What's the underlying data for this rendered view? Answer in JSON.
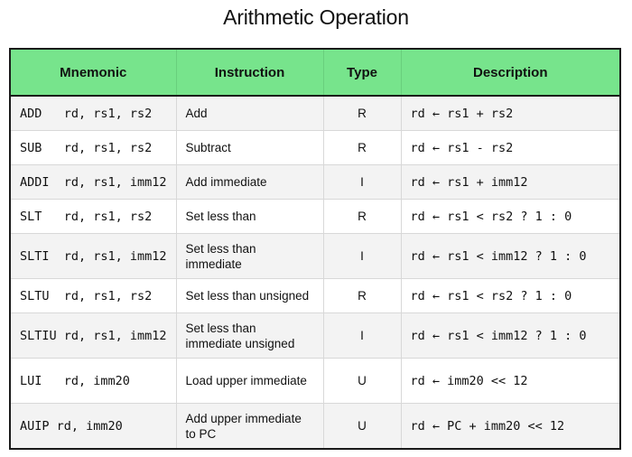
{
  "title": "Arithmetic Operation",
  "table": {
    "headers": [
      "Mnemonic",
      "Instruction",
      "Type",
      "Description"
    ],
    "rows": [
      {
        "mnemonic": "ADD   rd, rs1, rs2",
        "instruction": "Add",
        "type": "R",
        "description": "rd ← rs1 + rs2"
      },
      {
        "mnemonic": "SUB   rd, rs1, rs2",
        "instruction": "Subtract",
        "type": "R",
        "description": "rd ← rs1 - rs2"
      },
      {
        "mnemonic": "ADDI  rd, rs1, imm12",
        "instruction": "Add immediate",
        "type": "I",
        "description": "rd ← rs1 + imm12"
      },
      {
        "mnemonic": "SLT   rd, rs1, rs2",
        "instruction": "Set less than",
        "type": "R",
        "description": "rd ← rs1 < rs2 ? 1 : 0"
      },
      {
        "mnemonic": "SLTI  rd, rs1, imm12",
        "instruction": "Set less than immediate",
        "type": "I",
        "description": "rd ← rs1 < imm12 ? 1 : 0"
      },
      {
        "mnemonic": "SLTU  rd, rs1, rs2",
        "instruction": "Set less than unsigned",
        "type": "R",
        "description": "rd ← rs1 < rs2 ? 1 : 0"
      },
      {
        "mnemonic": "SLTIU rd, rs1, imm12",
        "instruction": "Set less than immediate  unsigned",
        "type": "I",
        "description": "rd ← rs1 < imm12 ? 1 : 0"
      },
      {
        "mnemonic": "LUI   rd, imm20",
        "instruction": "Load upper immediate",
        "type": "U",
        "description": "rd ← imm20 << 12"
      },
      {
        "mnemonic": "AUIP rd, imm20",
        "instruction": "Add upper immediate to PC",
        "type": "U",
        "description": "rd ← PC + imm20 << 12"
      }
    ]
  },
  "colors": {
    "header_bg": "#77e48c",
    "row_alt_bg": "#f3f3f3",
    "border": "#1a1a1a"
  }
}
